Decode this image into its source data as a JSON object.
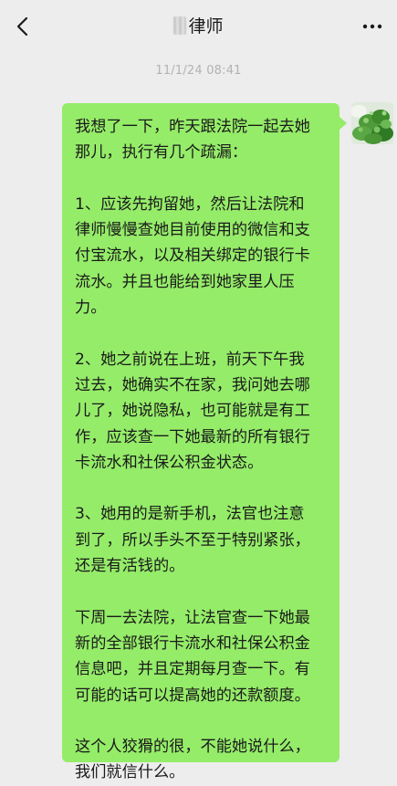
{
  "header": {
    "title": "律师",
    "back_icon": "chevron-left-icon",
    "more_icon": "more-dots-icon"
  },
  "chat": {
    "timestamp": "11/1/24 08:41",
    "message": {
      "sender": "self",
      "bubble_color": "#95ec69",
      "text": "我想了一下，昨天跟法院一起去她\n那儿，执行有几个疏漏：\n\n1、应该先拘留她，然后让法院和\n律师慢慢查她目前使用的微信和支\n付宝流水，以及相关绑定的银行卡\n流水。并且也能给到她家里人压\n力。\n\n2、她之前说在上班，前天下午我\n过去，她确实不在家，我问她去哪\n儿了，她说隐私，也可能就是有工\n作，应该查一下她最新的所有银行\n卡流水和社保公积金状态。\n\n3、她用的是新手机，法官也注意\n到了，所以手头不至于特别紧张，\n还是有活钱的。\n\n下周一去法院，让法官查一下她最\n新的全部银行卡流水和社保公积金\n信息吧，并且定期每月查一下。有\n可能的话可以提高她的还款额度。\n\n这个人狡猾的很，不能她说什么，\n我们就信什么。"
    }
  }
}
